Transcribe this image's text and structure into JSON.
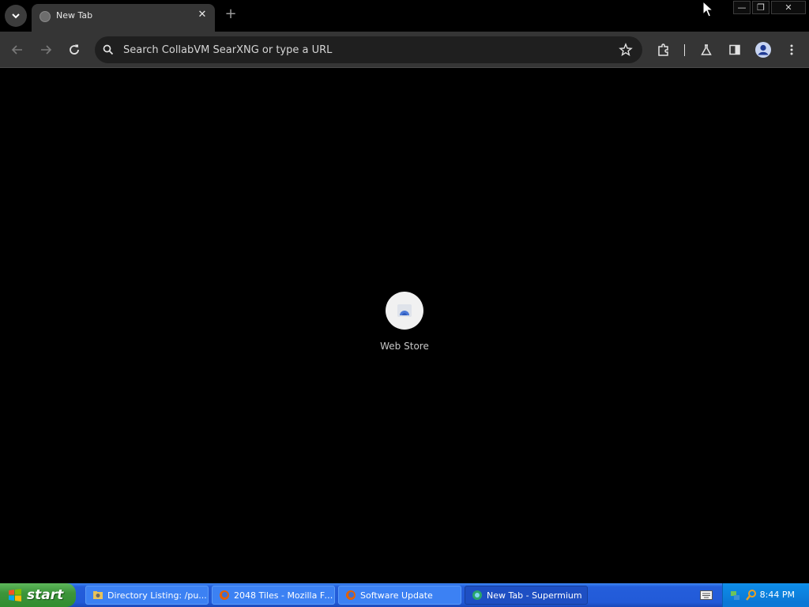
{
  "browser": {
    "tab": {
      "title": "New Tab",
      "close_glyph": "✕"
    },
    "new_tab_glyph": "+",
    "window_controls": {
      "minimize": "—",
      "restore": "❐",
      "close": "✕"
    },
    "omnibox": {
      "placeholder": "Search CollabVM SearXNG or type a URL",
      "value": ""
    }
  },
  "content": {
    "shortcut": {
      "label": "Web Store",
      "icon": "web-store-icon"
    }
  },
  "taskbar": {
    "start_label": "start",
    "tasks": [
      {
        "label": "Directory Listing: /pu...",
        "icon": "directory-icon",
        "active": false
      },
      {
        "label": "2048 Tiles - Mozilla Fir...",
        "icon": "firefox-icon",
        "active": false
      },
      {
        "label": "Software Update",
        "icon": "firefox-icon",
        "active": false
      },
      {
        "label": "New Tab - Supermium",
        "icon": "supermium-icon",
        "active": true
      }
    ],
    "clock": "8:44 PM"
  },
  "colors": {
    "tab_bg": "#353535",
    "toolbar_bg": "#353535",
    "omnibox_bg": "#1f1f1f",
    "content_bg": "#000000",
    "taskbar_blue": "#245edb",
    "start_green": "#3d953b"
  }
}
